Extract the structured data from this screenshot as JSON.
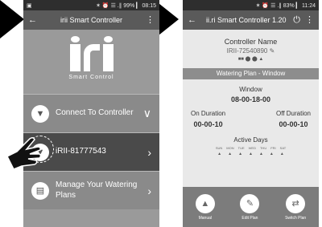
{
  "left_phone": {
    "status": {
      "left_icon": "▣",
      "right_text": "✶ ⏰ ☰ .∥ 99% ▎ 08:15"
    },
    "toolbar": {
      "back_icon": "←",
      "title": "irii Smart Controller",
      "menu_icon": "⋮"
    },
    "logo_text": "Smart Control",
    "rows": {
      "connect": {
        "label": "Connect To Controller",
        "icon": "▼",
        "chevron": "∨"
      },
      "device": {
        "label": "iRII-81777543",
        "icon": "▼",
        "chevron": "›"
      },
      "manage": {
        "label": "Manage Your Watering Plans",
        "icon": "▤",
        "chevron": "›"
      }
    }
  },
  "right_phone": {
    "status": {
      "right_text": "✶ ⏰ ☰ .∥ 83% ▎ 11:24"
    },
    "toolbar": {
      "back_icon": "←",
      "title": "ii.ri Smart Controller 1.20",
      "power_icon": "⏻",
      "menu_icon": "⋮"
    },
    "controller": {
      "heading": "Controller Name",
      "id": "IRII-72540890 ✎",
      "icons": "■■ ⬤ ⬤ ▲"
    },
    "section_title": "Watering Plan - Window",
    "window": {
      "label": "Window",
      "value": "08-00-18-00"
    },
    "on_duration": {
      "label": "On Duration",
      "value": "00-00-10"
    },
    "off_duration": {
      "label": "Off Duration",
      "value": "00-00-10"
    },
    "active_days": {
      "label": "Active Days",
      "days": [
        "SUN",
        "MON",
        "TUE",
        "WED",
        "THU",
        "FRI",
        "SAT"
      ],
      "drop_glyph": "▲"
    },
    "bottom_actions": [
      {
        "label": "Manual",
        "icon": "▲"
      },
      {
        "label": "Edit Plan",
        "icon": "✎"
      },
      {
        "label": "Switch Plan",
        "icon": "⇄"
      }
    ]
  }
}
